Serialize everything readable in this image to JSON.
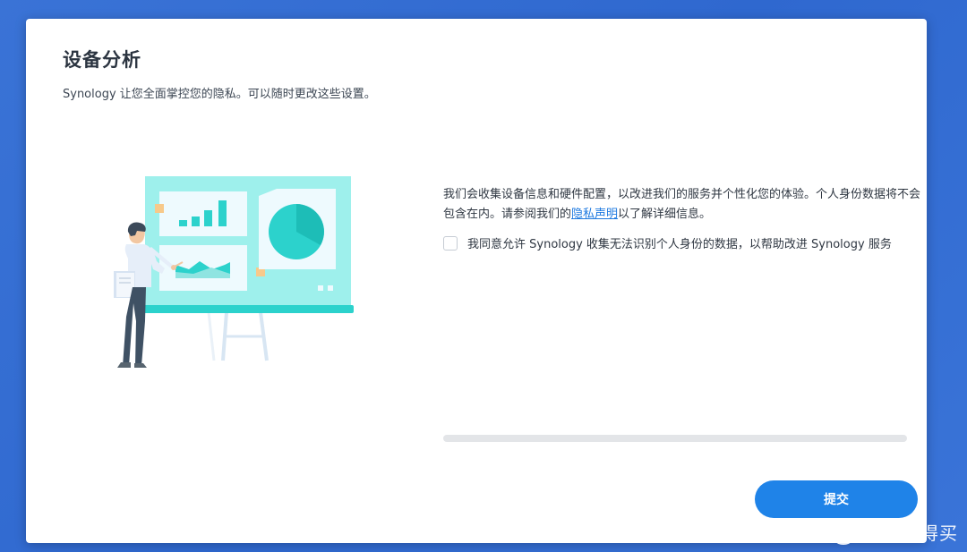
{
  "dialog": {
    "title": "设备分析",
    "subtitle": "Synology 让您全面掌控您的隐私。可以随时更改这些设置。",
    "description_before_link": "我们会收集设备信息和硬件配置，以改进我们的服务并个性化您的体验。个人身份数据将不会包含在内。请参阅我们的",
    "privacy_link": "隐私声明",
    "description_after_link": "以了解详细信息。",
    "consent_label": "我同意允许 Synology 收集无法识别个人身份的数据，以帮助改进 Synology 服务",
    "consent_checked": false,
    "progress": 0,
    "submit_label": "提交"
  },
  "watermark": {
    "logo_glyph": "值",
    "text": "什么值得买"
  },
  "colors": {
    "background": "#3a73d6",
    "accent": "#1f83e8",
    "link": "#1f7ae0",
    "illustration_board": "#9ef0ec",
    "illustration_teal": "#2cd2cc"
  },
  "icons": {
    "checkbox": "checkbox-unchecked-icon",
    "illustration": "presentation-board-illustration"
  }
}
